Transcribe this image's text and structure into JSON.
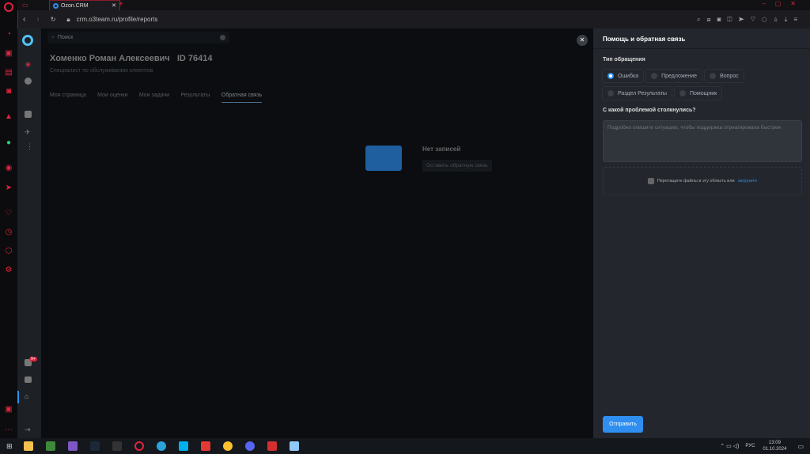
{
  "browser": {
    "tab_title": "Ozon.CRM",
    "url": "crm.o3team.ru/profile/reports"
  },
  "search": {
    "placeholder": "Поиск"
  },
  "profile": {
    "name": "Хоменко Роман Алексеевич",
    "id": "ID 76414",
    "role": "Специалист по обслуживанию клиентов"
  },
  "tabs": [
    {
      "label": "Моя страница"
    },
    {
      "label": "Мои оценки"
    },
    {
      "label": "Мои задачи"
    },
    {
      "label": "Результаты"
    },
    {
      "label": "Обратная связь",
      "active": true
    }
  ],
  "empty": {
    "title": "Нет записей",
    "button": "Оставить обратную связь"
  },
  "notification_badge": "9+",
  "panel": {
    "title": "Помощь и обратная связь",
    "type_label": "Тип обращения",
    "types": [
      {
        "label": "Ошибка",
        "selected": true
      },
      {
        "label": "Предложение"
      },
      {
        "label": "Вопрос"
      },
      {
        "label": "Раздел Результаты"
      },
      {
        "label": "Помощник"
      }
    ],
    "problem_label": "С какой проблемой столкнулись?",
    "problem_placeholder": "Подробно опишите ситуацию, чтобы поддержка отреагировала быстрее",
    "upload_text": "Перетащите файлы в эту область или",
    "upload_link": "загрузите",
    "submit": "Отправить"
  },
  "taskbar": {
    "lang": "РУС",
    "time": "13:09",
    "date": "01.10.2024"
  },
  "colors": {
    "accent": "#2f8ff0",
    "opera_red": "#e0243c"
  }
}
